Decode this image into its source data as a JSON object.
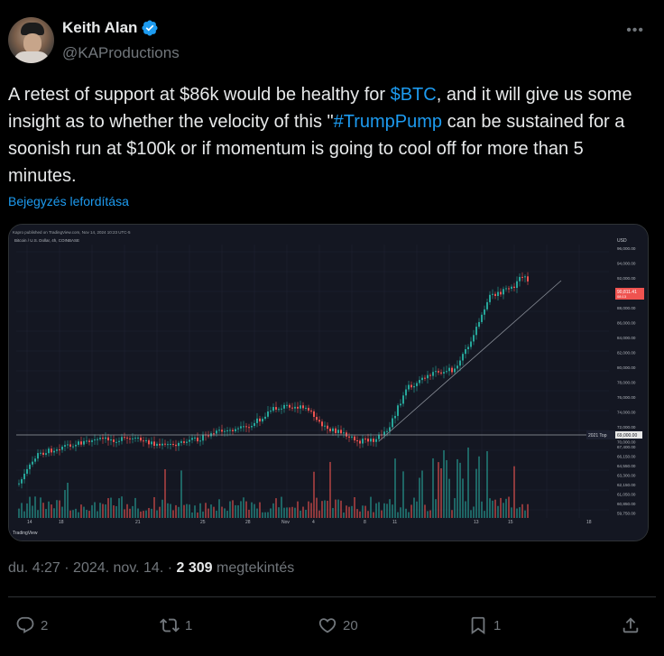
{
  "author": {
    "name": "Keith Alan",
    "handle": "@KAProductions"
  },
  "tweet": {
    "text_before_cashtag": "A retest of support at $86k would be healthy for ",
    "cashtag": "$BTC",
    "text_middle": ", and it will give us some insight as to whether the velocity of this \"",
    "hashtag": "#TrumpPump",
    "text_after": " can be sustained for a soonish run at $100k or if momentum is going to cool off for more than 5 minutes.",
    "translate_label": "Bejegyzés lefordítása"
  },
  "chart": {
    "publisher": "Kapro published on TradingView.com, Nov 14, 2024 10:23 UTC-5",
    "symbol": "Bitcoin / U.S. Dollar, 4h, COINBASE",
    "currency": "USD",
    "price_labels": [
      "96,000.00",
      "94,000.00",
      "92,000.00",
      "90,000.00",
      "88,000.00",
      "86,000.00",
      "84,000.00",
      "82,000.00",
      "80,000.00",
      "78,000.00",
      "76,000.00",
      "74,000.00",
      "72,000.00",
      "70,000.00"
    ],
    "volume_labels": [
      "67,400.00",
      "66,150.00",
      "64,550.00",
      "63,300.00",
      "62,150.00",
      "61,050.00",
      "60,850.00",
      "59,750.00"
    ],
    "x_labels": [
      "14",
      "18",
      "21",
      "25",
      "28",
      "Nov",
      "4",
      "8",
      "11",
      "13",
      "15",
      "18"
    ],
    "support_label": "2021 Top",
    "support_value": "69,000.00",
    "current_price": "90,811.41",
    "current_sub": "08:13",
    "logo_text": "TradingView"
  },
  "meta": {
    "time": "du. 4:27",
    "date": "2024. nov. 14.",
    "views": "2 309",
    "views_label": "megtekintés"
  },
  "actions": {
    "replies": "2",
    "reposts": "1",
    "likes": "20",
    "bookmarks": "1"
  },
  "colors": {
    "up": "#26a69a",
    "down": "#ef5350",
    "link": "#1d9bf0"
  }
}
